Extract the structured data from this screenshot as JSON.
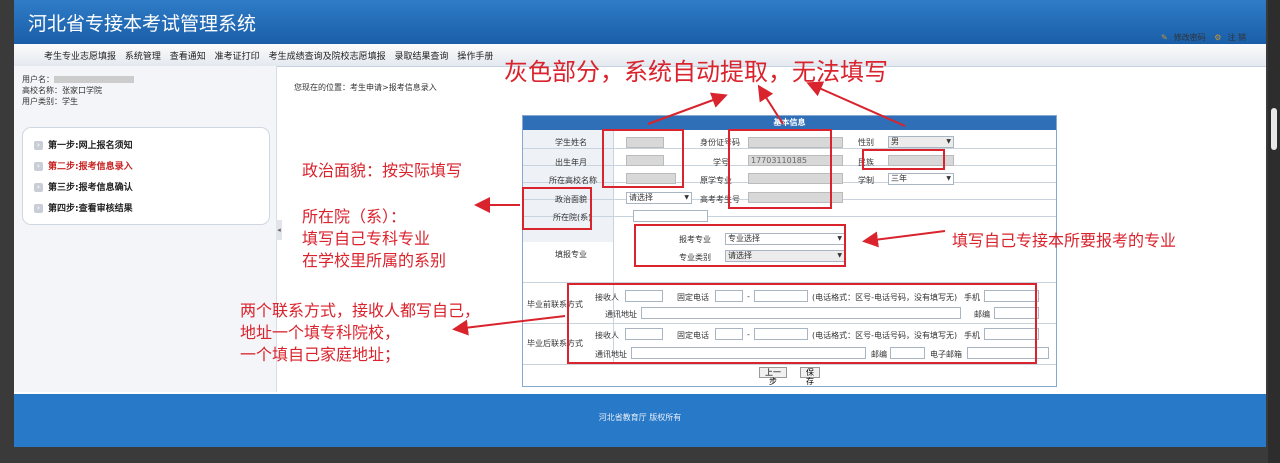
{
  "app": {
    "title": "河北省专接本考试管理系统"
  },
  "nav": {
    "items": [
      "考生专业志愿填报",
      "系统管理",
      "查看通知",
      "准考证打印",
      "考生成绩查询及院校志愿填报",
      "录取结果查询",
      "操作手册"
    ]
  },
  "toplinks": {
    "change_password": "修改密码",
    "logout": "注 销"
  },
  "user": {
    "name_label": "用户名：",
    "school_label": "高校名称：",
    "school_value": "张家口学院",
    "type_label": "用户类别：",
    "type_value": "学生"
  },
  "steps": [
    {
      "label": "第一步:网上报名须知"
    },
    {
      "label": "第二步:报考信息录入"
    },
    {
      "label": "第三步:报考信息确认"
    },
    {
      "label": "第四步:查看审核结果"
    }
  ],
  "breadcrumb": "您现在的位置：考生申请>报考信息录入",
  "form": {
    "header": "基本信息",
    "name_label": "学生姓名",
    "id_label": "身份证号码",
    "gender_label": "性别",
    "gender_value": "男",
    "birth_label": "出生年月",
    "student_no_label": "学号",
    "student_no_value": "17703110185",
    "ethnic_label": "民族",
    "school_label": "所在高校名称",
    "major_label": "原学专业",
    "duration_label": "学制",
    "duration_value": "三年",
    "politics_label": "政治面貌",
    "politics_value": "请选择",
    "exam_no_label": "高考考生号",
    "dept_label": "所在院(系)",
    "apply_label": "填报专业",
    "apply_major_label": "报考专业",
    "apply_major_value": "专业选择",
    "apply_cat_label": "专业类别",
    "apply_cat_value": "请选择",
    "contact_before_label": "毕业前联系方式",
    "contact_after_label": "毕业后联系方式",
    "receiver_label": "接收人",
    "phone_label": "固定电话",
    "dash": "-",
    "phone_hint": "(电话格式：区号-电话号码，没有填写无)",
    "mobile_label": "手机",
    "address_label": "通讯地址",
    "postcode_label": "邮编",
    "email_label": "电子邮箱",
    "prev_button": "上一步",
    "save_button": "保存"
  },
  "annotations": {
    "gray_title": "灰色部分，系统自动提取，无法填写",
    "politics_note": "政治面貌：按实际填写",
    "dept_note_1": "所在院（系）：",
    "dept_note_2": "填写自己专科专业",
    "dept_note_3": "在学校里所属的系别",
    "major_note": "填写自己专接本所要报考的专业",
    "contact_note_1": "两个联系方式，接收人都写自己，",
    "contact_note_2": "地址一个填专科院校，",
    "contact_note_3": "一个填自己家庭地址；"
  },
  "footer": {
    "text": "河北省教育厅 版权所有"
  },
  "colors": {
    "accent": "#1a5ea8",
    "annotation": "#d9232d",
    "footer": "#2879c7"
  }
}
